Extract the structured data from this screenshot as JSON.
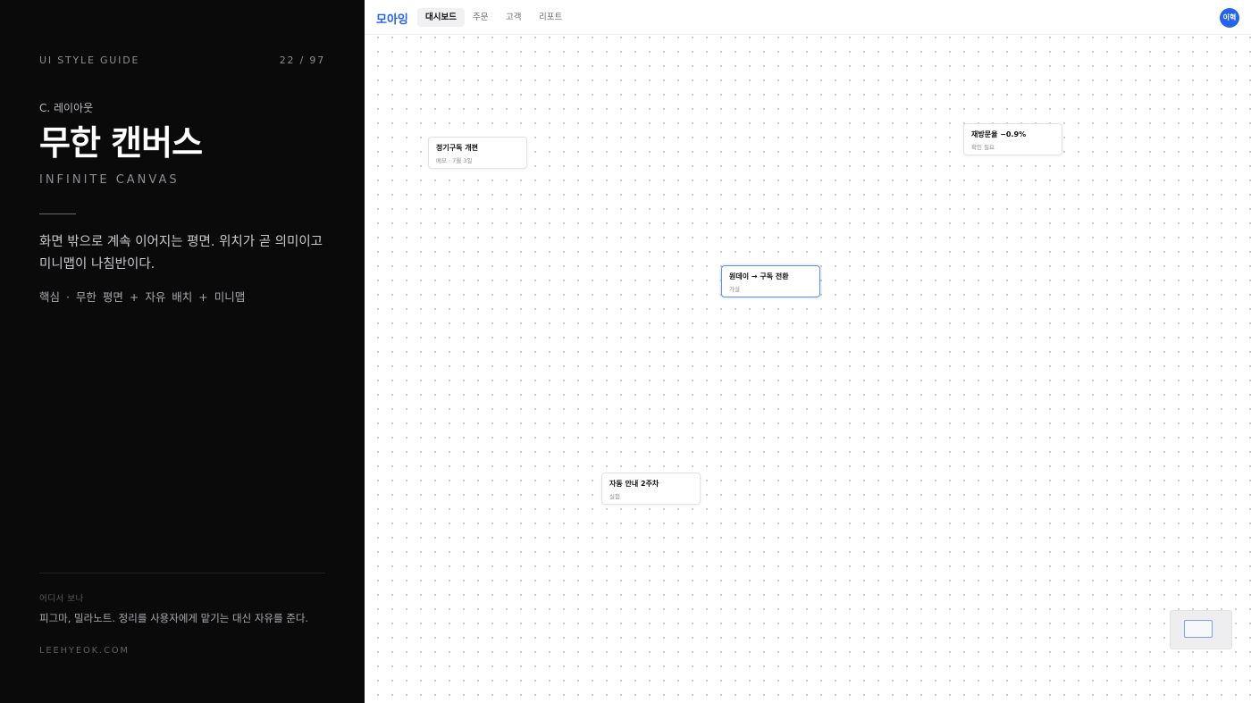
{
  "guide": {
    "label": "UI STYLE GUIDE",
    "page": "22 / 97",
    "section": "C. 레이아웃",
    "title": "무한 캔버스",
    "subtitle": "INFINITE CANVAS",
    "description": "화면 밖으로 계속 이어지는 평면. 위치가 곧 의미이고 미니맵이 나침반이다.",
    "keys": "핵심 · 무한 평면 + 자유 배치 + 미니맵",
    "reference_label": "어디서 보나",
    "reference_text": "피그마, 밀라노트. 정리를 사용자에게 맡기는 대신 자유를 준다.",
    "site": "LEEHYEOK.COM"
  },
  "app": {
    "brand": "모아잉",
    "tabs": [
      {
        "label": "대시보드",
        "active": true
      },
      {
        "label": "주문",
        "active": false
      },
      {
        "label": "고객",
        "active": false
      },
      {
        "label": "리포트",
        "active": false
      }
    ],
    "avatar": "이혁"
  },
  "canvas": {
    "cards": [
      {
        "title": "정기구독 개편",
        "sub": "메모 · 7월 3일"
      },
      {
        "title": "재방문율 −0.9%",
        "sub": "확인 필요"
      },
      {
        "title": "원데이 → 구독 전환",
        "sub": "가설",
        "selected": true
      },
      {
        "title": "자동 안내 2주차",
        "sub": "실험"
      }
    ]
  },
  "colors": {
    "accent": "#2563eb",
    "left_bg": "#0a0a0b"
  }
}
